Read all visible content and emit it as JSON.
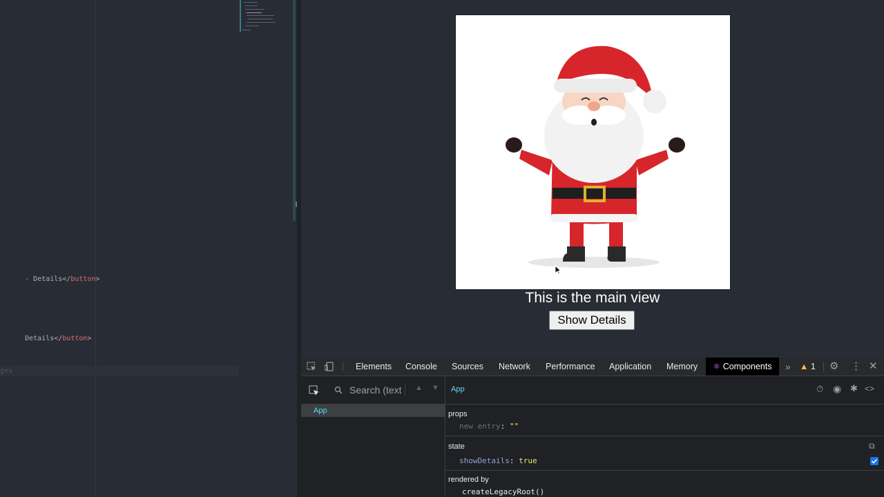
{
  "editor": {
    "line1_prefix": "Details</",
    "line1_tag": "button",
    "line1_suffix": ">",
    "line2_prefix": "Details</",
    "line2_tag": "button",
    "line2_suffix": ">",
    "faded_text": "ges"
  },
  "viewport": {
    "main_text": "This is the main view",
    "button_label": "Show Details",
    "image_icon": "santa-claus-illustration"
  },
  "devtools": {
    "tabs": [
      "Elements",
      "Console",
      "Sources",
      "Network",
      "Performance",
      "Application",
      "Memory"
    ],
    "active_tab": "Components",
    "warning_count": "1",
    "search_placeholder": "Search (text",
    "tree_item": "App",
    "selected_component": "App",
    "props_title": "props",
    "prop_key": "new entry",
    "prop_value": "\"\"",
    "state_title": "state",
    "state_key": "showDetails",
    "state_value": "true",
    "rendered_by_title": "rendered by",
    "rendered_by_value": "createLegacyRoot()",
    "colors": {
      "accent": "#61dafb",
      "active_tab_bg": "#000000",
      "warning": "#f9c02f"
    }
  }
}
